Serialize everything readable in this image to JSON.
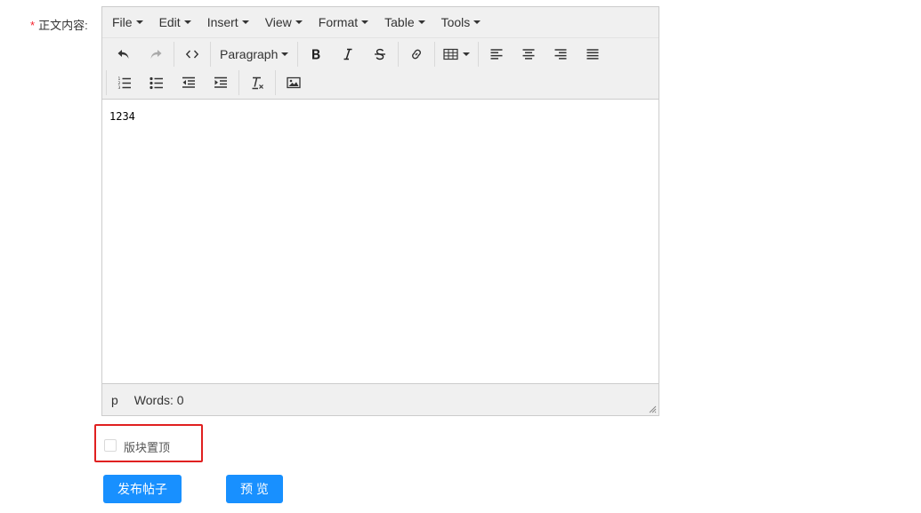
{
  "form": {
    "required_mark": "*",
    "content_label": "正文内容:"
  },
  "editor": {
    "menubar": [
      "File",
      "Edit",
      "Insert",
      "View",
      "Format",
      "Table",
      "Tools"
    ],
    "toolbar": {
      "paragraph_label": "Paragraph",
      "row1_icons": [
        "undo-icon",
        "redo-icon",
        "code-icon",
        "bold-icon",
        "italic-icon",
        "strikethrough-icon",
        "link-icon",
        "table-icon",
        "align-left-icon",
        "align-center-icon",
        "align-right-icon",
        "align-justify-icon"
      ],
      "row2_icons": [
        "numbered-list-icon",
        "bullet-list-icon",
        "outdent-icon",
        "indent-icon",
        "clear-format-icon",
        "image-icon"
      ]
    },
    "content_text": "1234",
    "status_path": "p",
    "word_count": "Words: 0"
  },
  "options": {
    "pin_label": "版块置顶",
    "pin_checked": false,
    "highlight_color": "#e02020"
  },
  "actions": {
    "publish_label": "发布帖子",
    "preview_label": "预 览",
    "primary_color": "#1890ff"
  }
}
